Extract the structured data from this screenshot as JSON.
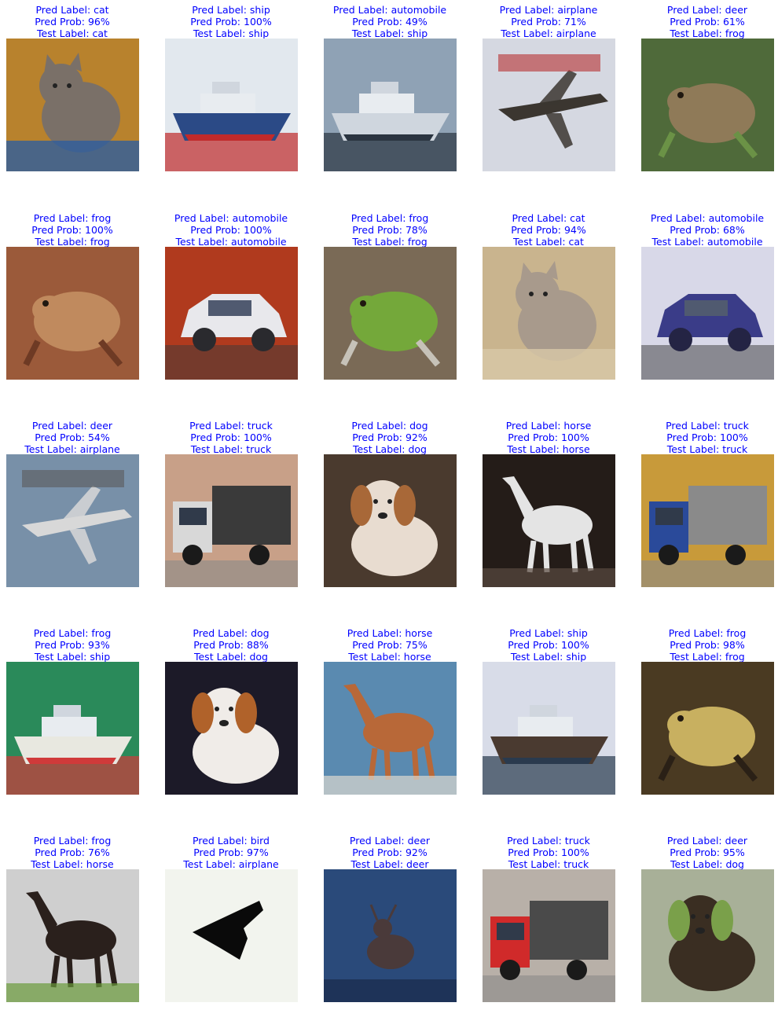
{
  "tiles": [
    {
      "pred": "Pred Label: cat",
      "prob": "Pred Prob: 96%",
      "test": "Test Label: cat",
      "subject": "cat",
      "colors": {
        "bg": "#b8822d",
        "a": "#7a7068",
        "b": "#2e5e9e"
      }
    },
    {
      "pred": "Pred Label: ship",
      "prob": "Pred Prob: 100%",
      "test": "Test Label: ship",
      "subject": "ship",
      "colors": {
        "bg": "#e2e8ee",
        "a": "#2b4a86",
        "b": "#c02a2a"
      }
    },
    {
      "pred": "Pred Label: automobile",
      "prob": "Pred Prob: 49%",
      "test": "Test Label: ship",
      "subject": "ship",
      "colors": {
        "bg": "#8fa2b5",
        "a": "#cfd6de",
        "b": "#2a3440"
      }
    },
    {
      "pred": "Pred Label: airplane",
      "prob": "Pred Prob: 71%",
      "test": "Test Label: airplane",
      "subject": "airplane",
      "colors": {
        "bg": "#d5d8e1",
        "a": "#3b3630",
        "b": "#b83030"
      }
    },
    {
      "pred": "Pred Label: deer",
      "prob": "Pred Prob: 61%",
      "test": "Test Label: frog",
      "subject": "frog",
      "colors": {
        "bg": "#4f6a3a",
        "a": "#8f7a58",
        "b": "#6b9246"
      }
    },
    {
      "pred": "Pred Label: frog",
      "prob": "Pred Prob: 100%",
      "test": "Test Label: frog",
      "subject": "frog",
      "colors": {
        "bg": "#9b5a3a",
        "a": "#c08a5e",
        "b": "#6e3a24"
      }
    },
    {
      "pred": "Pred Label: automobile",
      "prob": "Pred Prob: 100%",
      "test": "Test Label: automobile",
      "subject": "car",
      "colors": {
        "bg": "#b03a1e",
        "a": "#e8e8ec",
        "b": "#2a2a2e"
      }
    },
    {
      "pred": "Pred Label: frog",
      "prob": "Pred Prob: 78%",
      "test": "Test Label: frog",
      "subject": "frog",
      "colors": {
        "bg": "#7a6a56",
        "a": "#74a83a",
        "b": "#c6c2b8"
      }
    },
    {
      "pred": "Pred Label: cat",
      "prob": "Pred Prob: 94%",
      "test": "Test Label: cat",
      "subject": "cat",
      "colors": {
        "bg": "#c9b48e",
        "a": "#a89a8c",
        "b": "#d8c8a8"
      }
    },
    {
      "pred": "Pred Label: automobile",
      "prob": "Pred Prob: 68%",
      "test": "Test Label: automobile",
      "subject": "car",
      "colors": {
        "bg": "#d8d8e8",
        "a": "#3a3c88",
        "b": "#242444"
      }
    },
    {
      "pred": "Pred Label: deer",
      "prob": "Pred Prob: 54%",
      "test": "Test Label: airplane",
      "subject": "airplane",
      "colors": {
        "bg": "#7890a8",
        "a": "#d8d8d8",
        "b": "#5a5a5a"
      }
    },
    {
      "pred": "Pred Label: truck",
      "prob": "Pred Prob: 100%",
      "test": "Test Label: truck",
      "subject": "truck",
      "colors": {
        "bg": "#c8a088",
        "a": "#d8d8d8",
        "b": "#3a3a3a"
      }
    },
    {
      "pred": "Pred Label: dog",
      "prob": "Pred Prob: 92%",
      "test": "Test Label: dog",
      "subject": "dog",
      "colors": {
        "bg": "#4a3a2e",
        "a": "#e8dcd0",
        "b": "#a86838"
      }
    },
    {
      "pred": "Pred Label: horse",
      "prob": "Pred Prob: 100%",
      "test": "Test Label: horse",
      "subject": "horse",
      "colors": {
        "bg": "#241c18",
        "a": "#e4e4e4",
        "b": "#5a4a40"
      }
    },
    {
      "pred": "Pred Label: truck",
      "prob": "Pred Prob: 100%",
      "test": "Test Label: truck",
      "subject": "truck",
      "colors": {
        "bg": "#c89a3a",
        "a": "#2a4a9a",
        "b": "#8a8a8a"
      }
    },
    {
      "pred": "Pred Label: frog",
      "prob": "Pred Prob: 93%",
      "test": "Test Label: ship",
      "subject": "ship",
      "colors": {
        "bg": "#2a8a5a",
        "a": "#e8e8e0",
        "b": "#d03a3a"
      }
    },
    {
      "pred": "Pred Label: dog",
      "prob": "Pred Prob: 88%",
      "test": "Test Label: dog",
      "subject": "dog",
      "colors": {
        "bg": "#1c1a28",
        "a": "#f0ece8",
        "b": "#b0622a"
      }
    },
    {
      "pred": "Pred Label: horse",
      "prob": "Pred Prob: 75%",
      "test": "Test Label: horse",
      "subject": "horse",
      "colors": {
        "bg": "#5a8ab0",
        "a": "#b86838",
        "b": "#dcd8d0"
      }
    },
    {
      "pred": "Pred Label: ship",
      "prob": "Pred Prob: 100%",
      "test": "Test Label: ship",
      "subject": "ship",
      "colors": {
        "bg": "#d8dce8",
        "a": "#4a3a30",
        "b": "#2a3a4e"
      }
    },
    {
      "pred": "Pred Label: frog",
      "prob": "Pred Prob: 98%",
      "test": "Test Label: frog",
      "subject": "frog",
      "colors": {
        "bg": "#4a3a22",
        "a": "#c8b060",
        "b": "#2a2016"
      }
    },
    {
      "pred": "Pred Label: frog",
      "prob": "Pred Prob: 76%",
      "test": "Test Label: horse",
      "subject": "horse",
      "colors": {
        "bg": "#cfcfcf",
        "a": "#2a201c",
        "b": "#6a9a3a"
      }
    },
    {
      "pred": "Pred Label: bird",
      "prob": "Pred Prob: 97%",
      "test": "Test Label: airplane",
      "subject": "airplane-dark",
      "colors": {
        "bg": "#f2f4ee",
        "a": "#0a0a0a",
        "b": "#e0e2dc"
      }
    },
    {
      "pred": "Pred Label: deer",
      "prob": "Pred Prob: 92%",
      "test": "Test Label: deer",
      "subject": "deer",
      "colors": {
        "bg": "#2a4a7a",
        "a": "#4a3a3a",
        "b": "#1a2a4a"
      }
    },
    {
      "pred": "Pred Label: truck",
      "prob": "Pred Prob: 100%",
      "test": "Test Label: truck",
      "subject": "truck",
      "colors": {
        "bg": "#b8b0a8",
        "a": "#d02a2a",
        "b": "#4a4a4a"
      }
    },
    {
      "pred": "Pred Label: deer",
      "prob": "Pred Prob: 95%",
      "test": "Test Label: dog",
      "subject": "dog",
      "colors": {
        "bg": "#a8b098",
        "a": "#3a2e22",
        "b": "#7aa04a"
      }
    }
  ]
}
